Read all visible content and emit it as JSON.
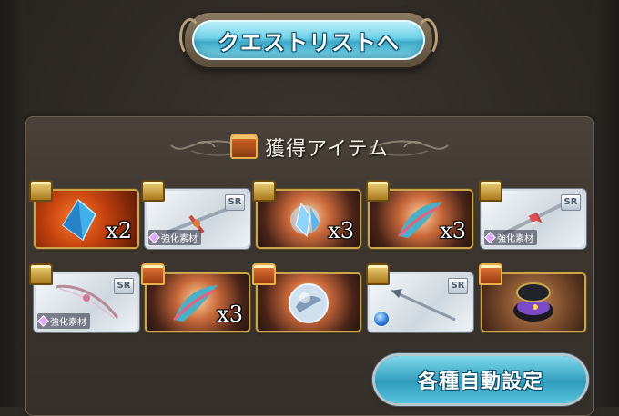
{
  "header": {
    "quest_list_label": "クエストリストへ"
  },
  "items_panel": {
    "title": "獲得アイテム",
    "rows": [
      [
        {
          "name": "blue-crystal",
          "frame": "gold",
          "bg": "orange",
          "chest": "gold",
          "quantity": "x2"
        },
        {
          "name": "sr-weapon-sword",
          "frame": "silver",
          "bg": "white",
          "chest": "gold",
          "rarity": "SR",
          "tag": "強化素材"
        },
        {
          "name": "blue-shard-orb",
          "frame": "gold",
          "bg": "sunset",
          "chest": "gold",
          "quantity": "x3"
        },
        {
          "name": "scale-fragment",
          "frame": "gold",
          "bg": "sunset",
          "chest": "gold",
          "quantity": "x3"
        },
        {
          "name": "sr-weapon-lance",
          "frame": "silver",
          "bg": "white",
          "chest": "gold",
          "rarity": "SR",
          "tag": "強化素材"
        }
      ],
      [
        {
          "name": "sr-weapon-bow",
          "frame": "silver",
          "bg": "white",
          "chest": "gold",
          "rarity": "SR",
          "tag": "強化素材"
        },
        {
          "name": "scale-fragment",
          "frame": "gold",
          "bg": "sunset",
          "chest": "red",
          "quantity": "x3"
        },
        {
          "name": "dragon-orb",
          "frame": "gold",
          "bg": "sunset",
          "chest": "red"
        },
        {
          "name": "sr-weapon-spear",
          "frame": "silver",
          "bg": "white",
          "chest": "gold",
          "rarity": "SR",
          "element": "water"
        },
        {
          "name": "jewel-box",
          "frame": "gold",
          "bg": "brown",
          "chest": "red"
        }
      ]
    ]
  },
  "footer": {
    "auto_settings_label": "各種自動設定"
  },
  "colors": {
    "accent_cyan": "#6fd1e8",
    "gold_frame": "#c9a54b",
    "panel": "#3d3630"
  }
}
